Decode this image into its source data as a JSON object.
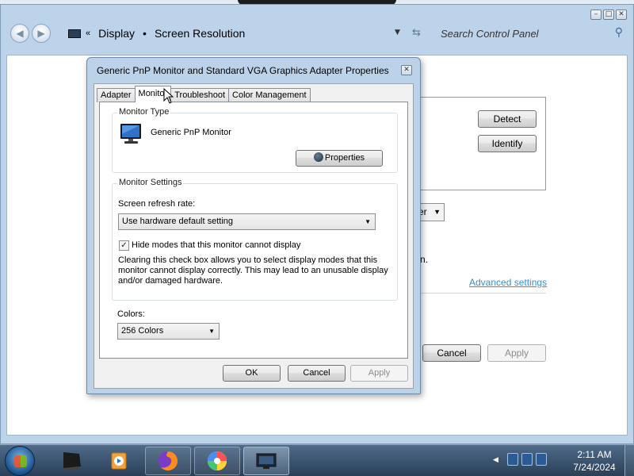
{
  "control_panel": {
    "breadcrumb": [
      "Display",
      "Screen Resolution"
    ],
    "search_placeholder": "Search Control Panel",
    "detect_label": "Detect",
    "identify_label": "Identify",
    "orientation_partial": "er",
    "partial_text": "n.",
    "advanced_link": "Advanced settings",
    "cancel_label": "Cancel",
    "apply_label": "Apply"
  },
  "dialog": {
    "title": "Generic PnP Monitor and Standard VGA Graphics Adapter Properties",
    "tabs": [
      "Adapter",
      "Monitor",
      "Troubleshoot",
      "Color Management"
    ],
    "active_tab": "Monitor",
    "monitor_type": {
      "label": "Monitor Type",
      "name": "Generic PnP Monitor",
      "properties_label": "Properties"
    },
    "monitor_settings": {
      "label": "Monitor Settings",
      "refresh_label": "Screen refresh rate:",
      "refresh_value": "Use hardware default setting",
      "hide_modes_checked": true,
      "hide_modes_label": "Hide modes that this monitor cannot display",
      "description": "Clearing this check box allows you to select display modes that this monitor cannot display correctly. This may lead to an unusable display and/or damaged hardware."
    },
    "colors": {
      "label": "Colors:",
      "value": "256 Colors"
    },
    "ok_label": "OK",
    "cancel_label": "Cancel",
    "apply_label": "Apply"
  },
  "taskbar": {
    "time": "2:11 AM",
    "date": "7/24/2024"
  }
}
